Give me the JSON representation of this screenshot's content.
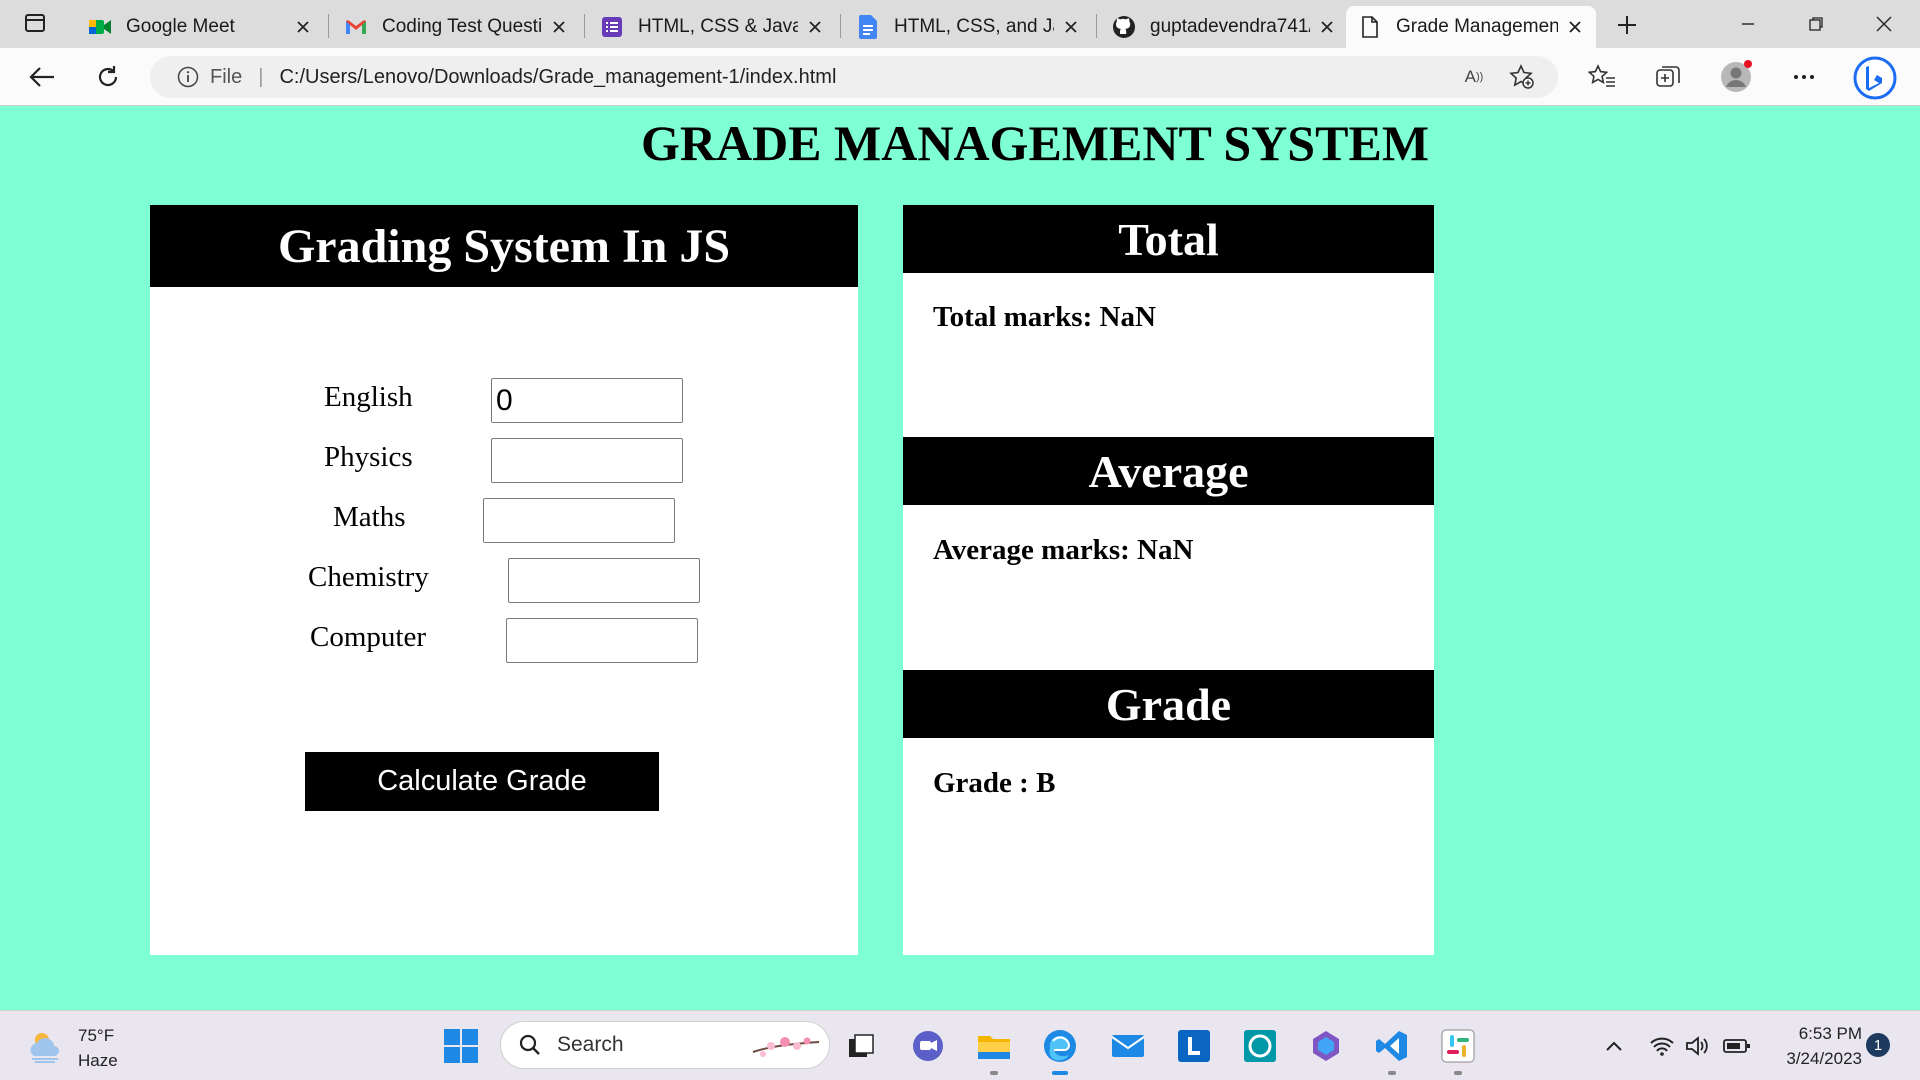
{
  "browser": {
    "tabs": [
      {
        "title": "Google Meet"
      },
      {
        "title": "Coding Test Questic"
      },
      {
        "title": "HTML, CSS & Javasc"
      },
      {
        "title": "HTML, CSS, and Jav"
      },
      {
        "title": "guptadevendra741/"
      },
      {
        "title": "Grade Managemen"
      }
    ],
    "address": {
      "scheme_label": "File",
      "url": "C:/Users/Lenovo/Downloads/Grade_management-1/index.html"
    }
  },
  "page": {
    "title": "GRADE MANAGEMENT SYSTEM",
    "form": {
      "heading": "Grading System In JS",
      "fields": [
        {
          "label": "English",
          "value": "0"
        },
        {
          "label": "Physics",
          "value": ""
        },
        {
          "label": "Maths",
          "value": ""
        },
        {
          "label": "Chemistry",
          "value": ""
        },
        {
          "label": "Computer",
          "value": ""
        }
      ],
      "button_label": "Calculate Grade"
    },
    "results": {
      "total_heading": "Total",
      "total_text": "Total marks: NaN",
      "average_heading": "Average",
      "average_text": "Average marks: NaN",
      "grade_heading": "Grade",
      "grade_text": "Grade : B"
    },
    "colors": {
      "background": "#7fffd4",
      "header": "#000000"
    }
  },
  "taskbar": {
    "weather": {
      "temp": "75°F",
      "condition": "Haze"
    },
    "search_placeholder": "Search",
    "time": "6:53 PM",
    "date": "3/24/2023",
    "notification_count": "1"
  }
}
